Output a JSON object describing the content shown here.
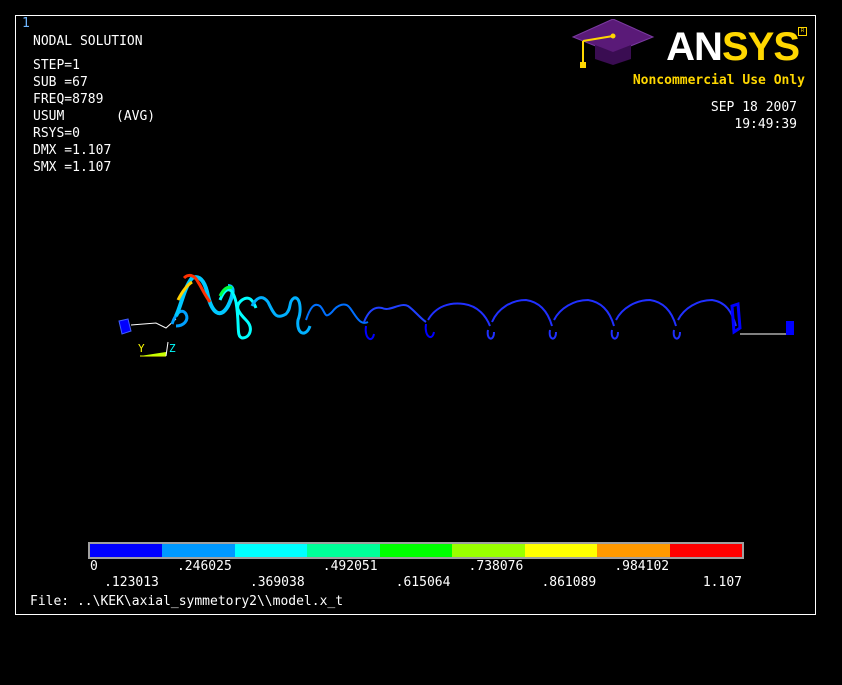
{
  "window_number": "1",
  "info": {
    "title": "NODAL SOLUTION",
    "step": "STEP=1",
    "sub": "SUB =67",
    "freq": "FREQ=8789",
    "usum": "USUM",
    "avg": "(AVG)",
    "rsys": "RSYS=0",
    "dmx": "DMX =1.107",
    "smx": "SMX =1.107"
  },
  "date": "SEP 18 2007",
  "time": "19:49:39",
  "logo": {
    "text_an": "AN",
    "text_sys": "SYS",
    "registered": "R",
    "subtitle": "Noncommercial Use Only"
  },
  "triad": {
    "y": "Y",
    "z": "Z"
  },
  "legend": {
    "colors": [
      "#0000ff",
      "#0099ff",
      "#00ffff",
      "#00ff99",
      "#00ff00",
      "#99ff00",
      "#ffff00",
      "#ff9900",
      "#ff0000"
    ],
    "labels_upper": [
      "0",
      ".246025",
      ".492051",
      ".738076",
      ".984102"
    ],
    "labels_lower": [
      ".123013",
      ".369038",
      ".615064",
      ".861089",
      "1.107"
    ]
  },
  "file": "File: ..\\KEK\\axial_symmetory2\\\\model.x_t",
  "colors": {
    "background": "#000000",
    "frame": "#ffffff",
    "logo_yellow": "#ffd700",
    "hat_purple": "#5a1a78"
  }
}
